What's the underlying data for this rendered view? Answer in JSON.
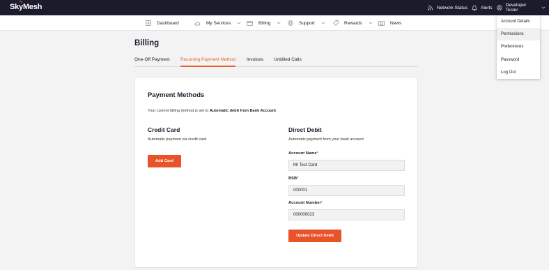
{
  "topbar": {
    "logo": "SkyMesh",
    "network_status": "Network Status",
    "alerts": "Alerts",
    "user": "Developer Tester",
    "icons": [
      "rss-icon",
      "bell-icon",
      "user-icon",
      "chevron-down-icon"
    ]
  },
  "nav": {
    "items": [
      {
        "label": "Dashboard",
        "icon": "dashboard-icon"
      },
      {
        "label": "My Services",
        "icon": "cloud-icon"
      },
      {
        "label": "Billing",
        "icon": "credit-card-icon"
      },
      {
        "label": "Support",
        "icon": "lifebuoy-icon"
      },
      {
        "label": "Rewards",
        "icon": "tag-icon"
      },
      {
        "label": "News",
        "icon": "newspaper-icon"
      }
    ]
  },
  "user_menu": {
    "items": [
      "Account Details",
      "Permissions",
      "Preferences",
      "Password",
      "Log Out"
    ],
    "highlighted": "Permissions"
  },
  "page": {
    "title": "Billing",
    "tabs": [
      "One-Off Payment",
      "Recurring Payment Method",
      "Invoices",
      "Unbilled Calls"
    ],
    "active_tab": "Recurring Payment Method"
  },
  "payment_methods": {
    "title": "Payment Methods",
    "intro_prefix": "Your current billing method is set to ",
    "intro_method": "Automatic debit from Bank Account",
    "intro_suffix": ".",
    "credit_card": {
      "title": "Credit Card",
      "description": "Automatic payment via credit card",
      "button": "Add Card"
    },
    "direct_debit": {
      "title": "Direct Debit",
      "description": "Automatic payment from your bank account",
      "required_mark": "*",
      "account_name_label": "Account Name",
      "account_name_value": "Mr Test Card",
      "bsb_label": "BSB",
      "bsb_value": "000001",
      "account_number_label": "Account Number",
      "account_number_value": "000000023",
      "button": "Update Direct Debit"
    }
  },
  "colors": {
    "accent": "#e8532a",
    "topbar_bg": "#1b1b2b"
  }
}
